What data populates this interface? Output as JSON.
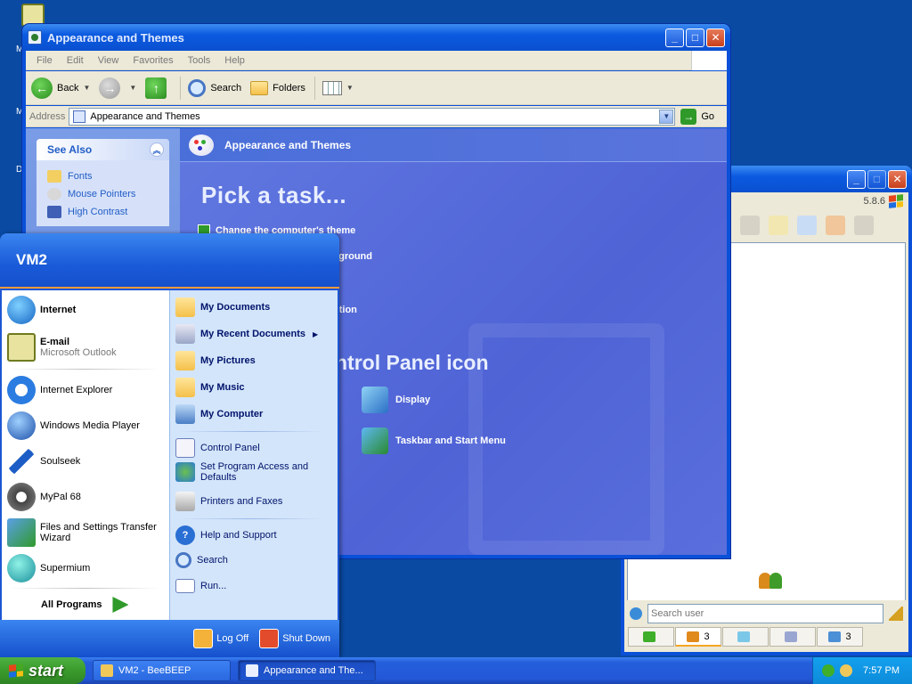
{
  "desktop": {
    "icons": [
      {
        "label": "M"
      },
      {
        "label": "M"
      },
      {
        "label": "D"
      }
    ]
  },
  "main_window": {
    "title": "Appearance and Themes",
    "menu": [
      "File",
      "Edit",
      "View",
      "Favorites",
      "Tools",
      "Help"
    ],
    "toolbar": {
      "back": "Back",
      "search": "Search",
      "folders": "Folders"
    },
    "address": {
      "label": "Address",
      "value": "Appearance and Themes",
      "go": "Go"
    },
    "see_also": {
      "title": "See Also",
      "items": [
        "Fonts",
        "Mouse Pointers",
        "High Contrast"
      ]
    },
    "header": "Appearance and Themes",
    "pick_task": "Pick a task...",
    "tasks": [
      "Change the computer's theme",
      "kground",
      "ution"
    ],
    "pick_icon": "ntrol Panel icon",
    "icons": [
      "Display",
      "Taskbar and Start Menu"
    ]
  },
  "bee_window": {
    "version": "5.8.6",
    "search_placeholder": "Search user",
    "tabs": [
      {
        "count": ""
      },
      {
        "count": "3"
      },
      {
        "count": ""
      },
      {
        "count": ""
      },
      {
        "count": "3"
      }
    ]
  },
  "start_menu": {
    "user": "VM2",
    "pinned": [
      {
        "label": "Internet",
        "sub": ""
      },
      {
        "label": "E-mail",
        "sub": "Microsoft Outlook"
      }
    ],
    "recent": [
      {
        "label": "Internet Explorer"
      },
      {
        "label": "Windows Media Player"
      },
      {
        "label": "Soulseek"
      },
      {
        "label": "MyPal 68"
      },
      {
        "label": "Files and Settings Transfer Wizard"
      },
      {
        "label": "Supermium"
      }
    ],
    "all_programs": "All Programs",
    "places": [
      {
        "label": "My Documents"
      },
      {
        "label": "My Recent Documents"
      },
      {
        "label": "My Pictures"
      },
      {
        "label": "My Music"
      },
      {
        "label": "My Computer"
      }
    ],
    "system": [
      {
        "label": "Control Panel"
      },
      {
        "label": "Set Program Access and Defaults"
      },
      {
        "label": "Printers and Faxes"
      }
    ],
    "help": [
      {
        "label": "Help and Support"
      },
      {
        "label": "Search"
      },
      {
        "label": "Run..."
      }
    ],
    "log_off": "Log Off",
    "shut_down": "Shut Down"
  },
  "taskbar": {
    "start": "start",
    "buttons": [
      {
        "label": "VM2 - BeeBEEP",
        "active": false
      },
      {
        "label": "Appearance and The...",
        "active": true
      }
    ],
    "clock": "7:57 PM"
  },
  "colors": {
    "desktop": "#0a4aa3",
    "title_blue": "#0a50d8",
    "start_green": "#3a9b2c",
    "pane_purple": "#5a6fdc"
  }
}
